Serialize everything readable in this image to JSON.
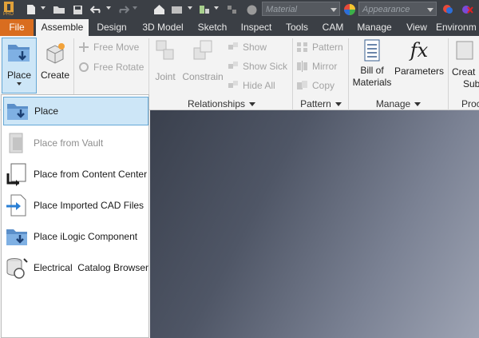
{
  "qat": {
    "logo_text": "PRO",
    "material_placeholder": "Material",
    "appearance_placeholder": "Appearance"
  },
  "tabs": [
    "File",
    "Assemble",
    "Design",
    "3D Model",
    "Sketch",
    "Inspect",
    "Tools",
    "CAM",
    "Manage",
    "View",
    "Environm"
  ],
  "ribbon": {
    "place": {
      "line1": "Place"
    },
    "create": "Create",
    "free_move": "Free Move",
    "free_rotate": "Free Rotate",
    "joint": "Joint",
    "constrain": "Constrain",
    "show": "Show",
    "show_sick": "Show Sick",
    "hide_all": "Hide All",
    "pattern": "Pattern",
    "mirror": "Mirror",
    "copy": "Copy",
    "bom_line1": "Bill of",
    "bom_line2": "Materials",
    "parameters": "Parameters",
    "create_sub_line1": "Creat",
    "create_sub_line2": "Sub",
    "panels": {
      "relationships": "Relationships",
      "pattern": "Pattern",
      "manage": "Manage",
      "productivity": "Proc"
    }
  },
  "menu": {
    "items": [
      {
        "label": "Place",
        "icon": "place-icon"
      },
      {
        "label": "Place from Vault",
        "icon": "vault-icon"
      },
      {
        "label": "Place from Content Center",
        "icon": "content-center-icon"
      },
      {
        "label": "Place Imported CAD Files",
        "icon": "import-cad-icon"
      },
      {
        "label": "Place iLogic Component",
        "icon": "ilogic-icon"
      },
      {
        "label": "Electrical  Catalog Browser",
        "icon": "electrical-catalog-icon"
      }
    ]
  },
  "colors": {
    "file_tab": "#d96d1f",
    "title_bar": "#3b3f45",
    "menu_selected": "#cde6f7"
  }
}
